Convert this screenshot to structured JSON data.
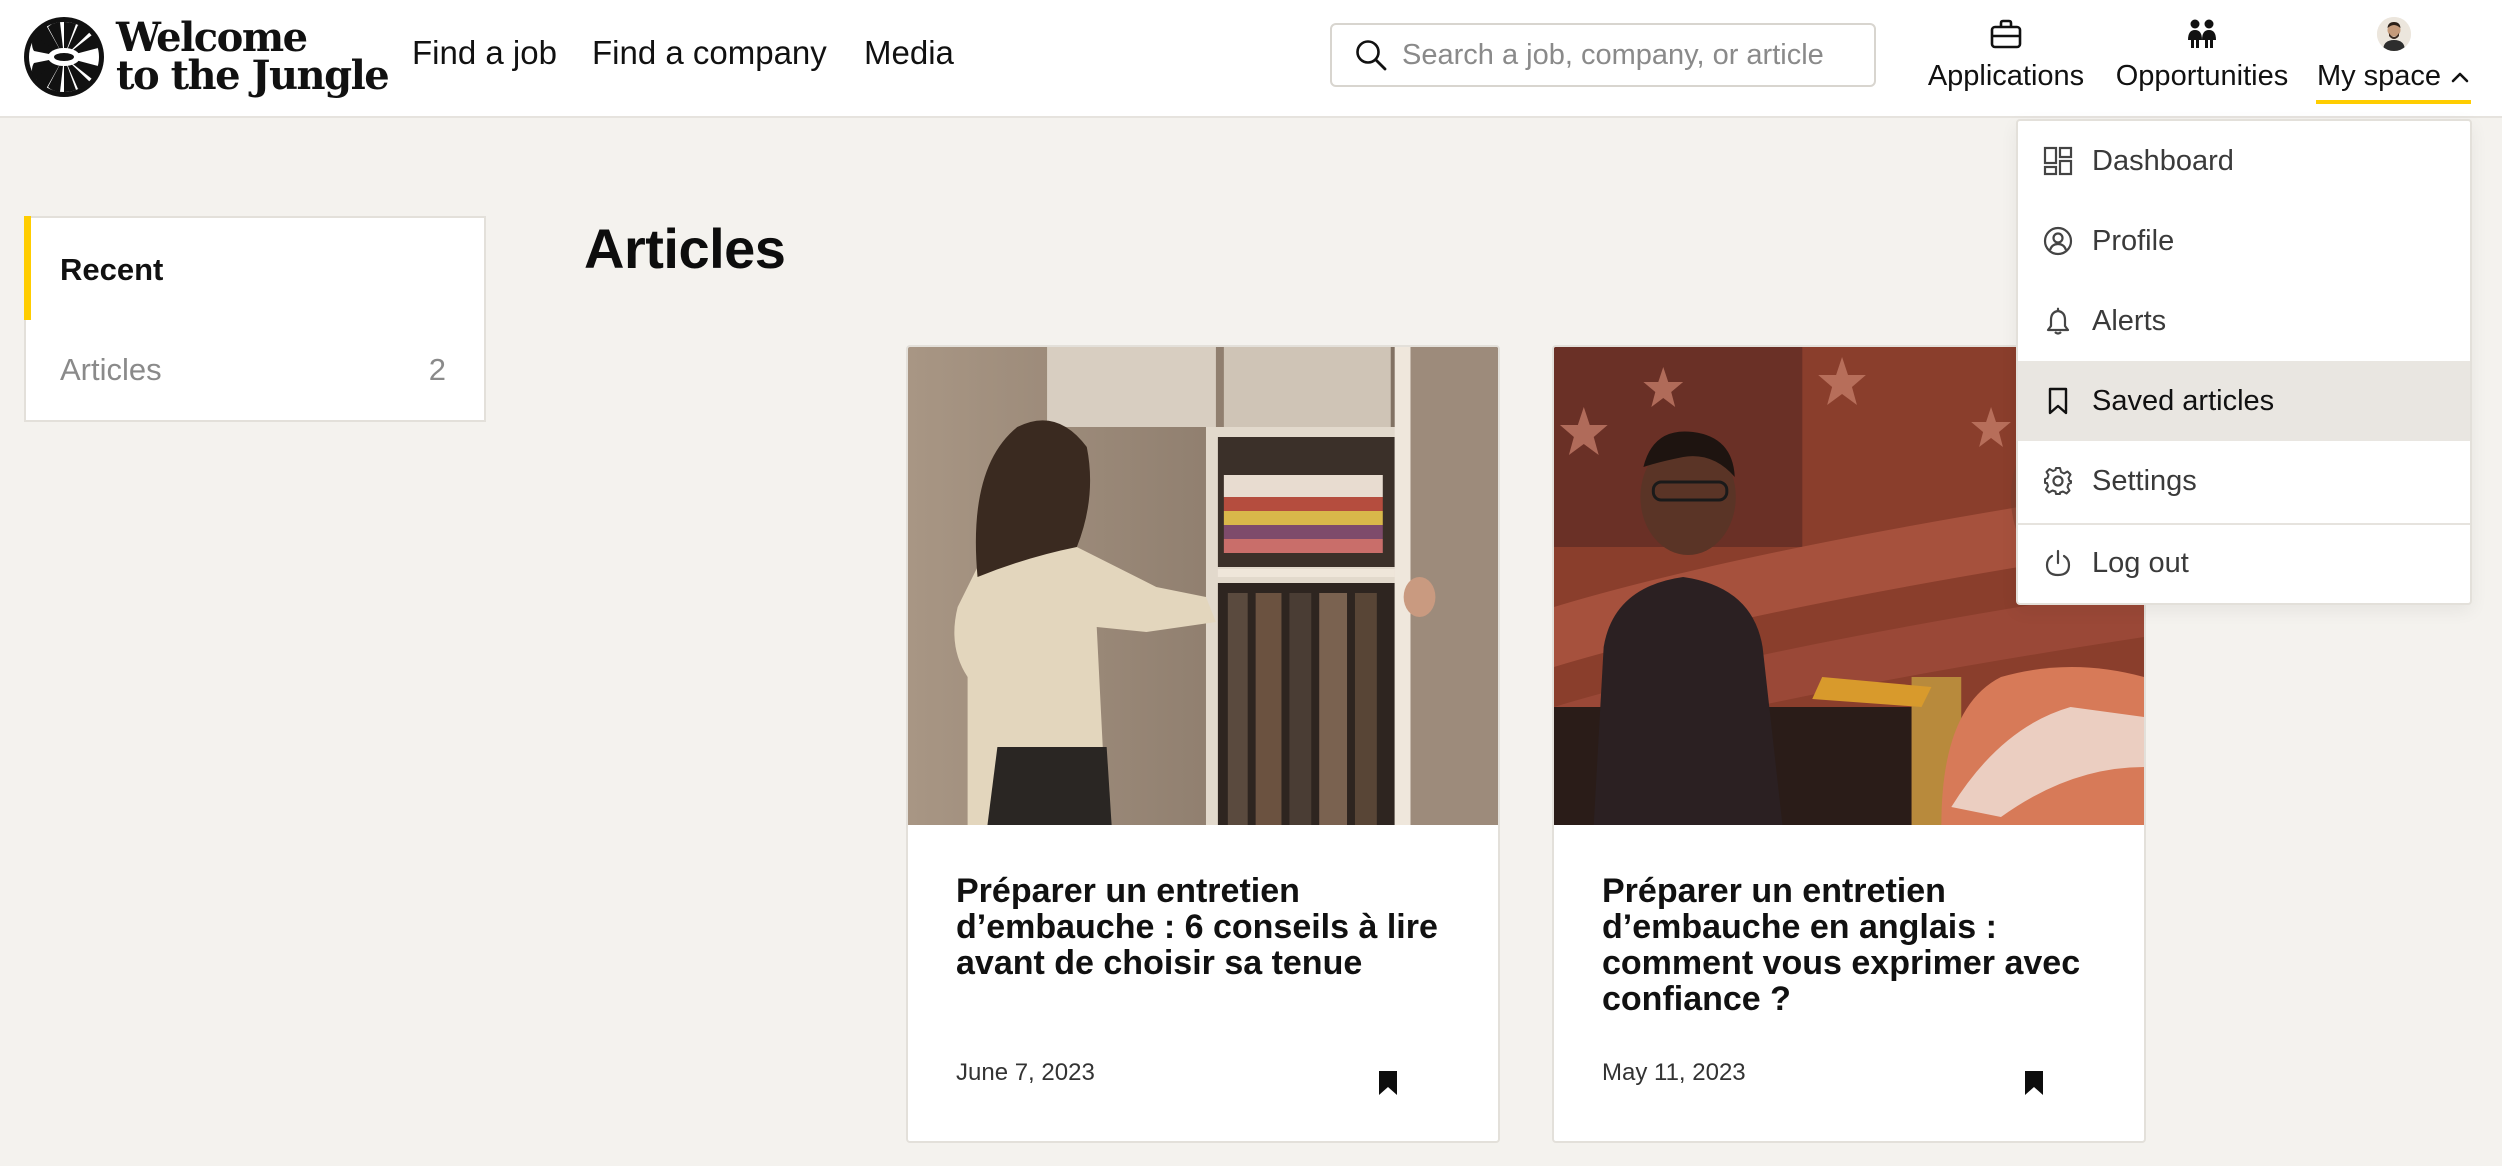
{
  "brand": {
    "name_line1": "Welcome",
    "name_line2": "to the Jungle"
  },
  "nav": {
    "find_job": "Find a job",
    "find_company": "Find a company",
    "media": "Media"
  },
  "search": {
    "placeholder": "Search a job, company, or article",
    "value": ""
  },
  "header_actions": {
    "applications": "Applications",
    "opportunities": "Opportunities",
    "my_space": "My space"
  },
  "sidebar": {
    "recent": "Recent",
    "articles_label": "Articles",
    "articles_count": "2"
  },
  "main": {
    "title": "Articles",
    "cards": [
      {
        "title": "Préparer un entretien d’embauche : 6 conseils à lire avant de choisir sa tenue",
        "date": "June 7, 2023",
        "image": "woman-opening-wardrobe-photo",
        "bookmark_icon": "bookmark-filled-icon"
      },
      {
        "title": "Préparer un entretien d’embauche en anglais : comment vous exprimer avec confiance ?",
        "date": "May 11, 2023",
        "image": "job-interview-flag-background-photo",
        "bookmark_icon": "bookmark-filled-icon"
      }
    ]
  },
  "dropdown": {
    "items": [
      {
        "label": "Dashboard",
        "icon": "dashboard-icon"
      },
      {
        "label": "Profile",
        "icon": "profile-icon"
      },
      {
        "label": "Alerts",
        "icon": "bell-icon"
      },
      {
        "label": "Saved articles",
        "icon": "bookmark-icon",
        "active": true
      },
      {
        "label": "Settings",
        "icon": "gear-icon"
      },
      {
        "label": "Log out",
        "icon": "power-icon"
      }
    ]
  },
  "colors": {
    "accent": "#ffcd00",
    "background": "#f4f2ee",
    "active_item": "#e9e6e1"
  }
}
